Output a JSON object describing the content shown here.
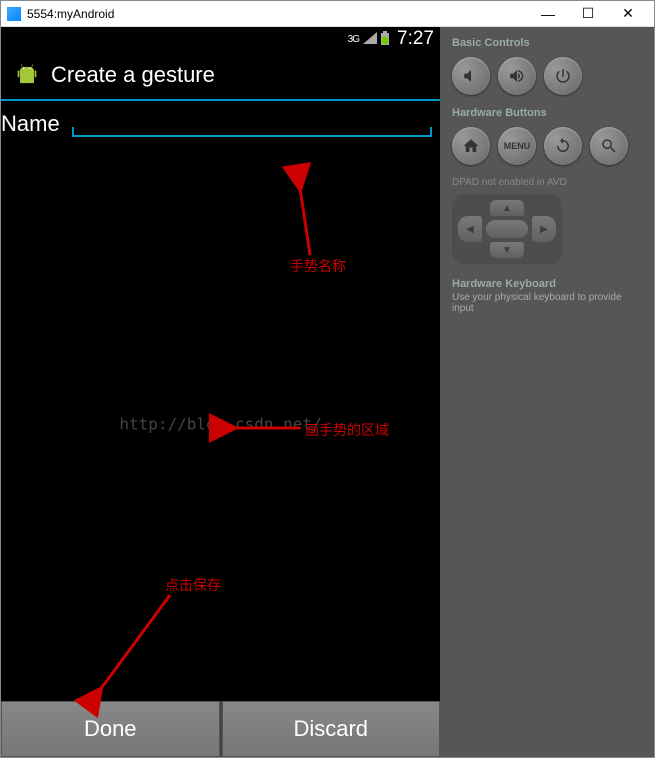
{
  "window": {
    "title": "5554:myAndroid"
  },
  "statusbar": {
    "network": "3G",
    "time": "7:27"
  },
  "app": {
    "title": "Create a gesture",
    "name_label": "Name",
    "name_value": ""
  },
  "buttons": {
    "done": "Done",
    "discard": "Discard"
  },
  "watermark": "http://blog.csdn.net/",
  "sidebar": {
    "basic_controls": "Basic Controls",
    "hardware_buttons": "Hardware Buttons",
    "menu_label": "MENU",
    "dpad_label": "DPAD not enabled in AVD",
    "hw_keyboard_title": "Hardware Keyboard",
    "hw_keyboard_sub": "Use your physical keyboard to provide input"
  },
  "annotations": {
    "gesture_name": "手势名称",
    "draw_area": "画手势的区域",
    "click_save": "点击保存"
  }
}
